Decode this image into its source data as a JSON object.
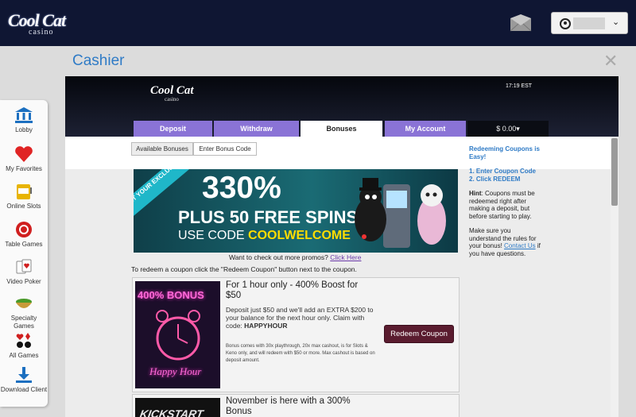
{
  "header": {
    "logo_main": "Cool Cat",
    "logo_sub": "casino",
    "mail_icon": "mail-icon",
    "account_caret": "⌄"
  },
  "cashier": {
    "title": "Cashier",
    "close_label": "✕",
    "time": "17:19 EST",
    "mini_logo_main": "Cool Cat",
    "mini_logo_sub": "casino",
    "balance": "$ 0.00▾"
  },
  "tabs": [
    {
      "label": "Deposit"
    },
    {
      "label": "Withdraw"
    },
    {
      "label": "Bonuses"
    },
    {
      "label": "My Account"
    }
  ],
  "subtabs": [
    {
      "label": "Available Bonuses"
    },
    {
      "label": "Enter Bonus Code"
    }
  ],
  "sidebar": {
    "items": [
      {
        "label": "Lobby",
        "icon": "bank-icon"
      },
      {
        "label": "My Favorites",
        "icon": "heart-icon"
      },
      {
        "label": "Online Slots",
        "icon": "slot-machine-icon"
      },
      {
        "label": "Table Games",
        "icon": "poker-chip-icon"
      },
      {
        "label": "Video Poker",
        "icon": "cards-icon"
      },
      {
        "label": "Specialty Games",
        "icon": "bowl-icon"
      },
      {
        "label": "All Games",
        "icon": "suits-icon"
      },
      {
        "label": "Download Client",
        "icon": "download-icon"
      }
    ]
  },
  "banner": {
    "ribbon": "GET YOUR EXCLUSIVE",
    "big": "330%",
    "mid": "PLUS 50 FREE SPINS",
    "code_prefix": "USE CODE",
    "code": "COOLWELCOME"
  },
  "promo": {
    "question": "Want to check out more promos?",
    "link": "Click Here",
    "redeem_info": "To redeem a coupon click the \"Redeem Coupon\" button next to the coupon."
  },
  "coupons": [
    {
      "thumb_title": "400% BONUS",
      "thumb_sub": "Happy Hour",
      "title": "For 1 hour only - 400% Boost for $50",
      "desc": "Deposit just $50 and we'll add an EXTRA $200 to your balance for the next hour only. Claim with code:",
      "code": "HAPPYHOUR",
      "fine": "Bonus comes with 30x playthrough, 20x max cashout, is for Slots & Keno only, and will redeem with $50 or more. Max cashout is based on deposit amount.",
      "button": "Redeem Coupon"
    },
    {
      "thumb_title": "KICKSTART",
      "title": "November is here with a 300% Bonus"
    }
  ],
  "right": {
    "heading": "Redeeming Coupons is Easy!",
    "step1": "1. Enter Coupon Code",
    "step2": "2. Click REDEEM",
    "hint_label": "Hint",
    "hint": ": Coupons must be redeemed right after making a deposit, but before starting to play.",
    "rules": "Make sure you understand the rules for your bonus!",
    "contact": "Contact Us",
    "rules_tail": "if you have questions."
  }
}
